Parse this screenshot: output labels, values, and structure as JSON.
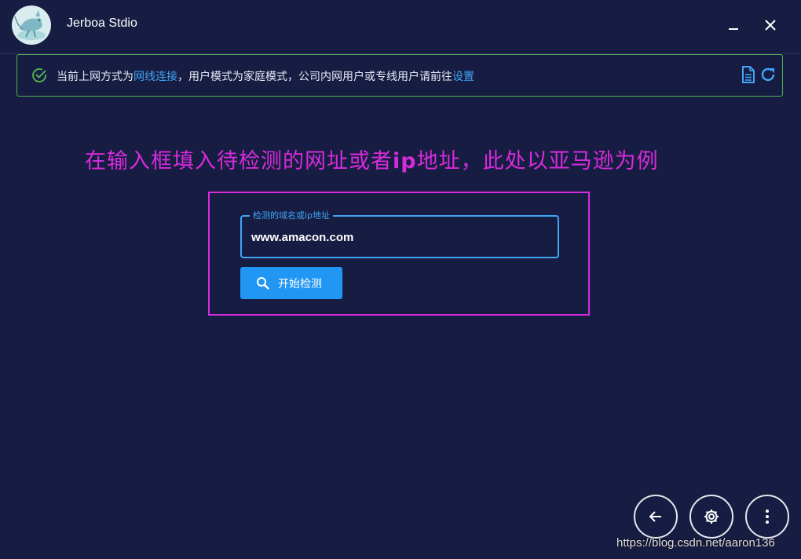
{
  "app": {
    "title": "Jerboa Stdio"
  },
  "banner": {
    "text_prefix": "当前上网方式为",
    "link_network": "网线连接",
    "text_middle": "，用户模式为家庭模式，公司内网用户或专线用户请前往",
    "link_settings": "设置",
    "status_color": "#4caf50",
    "link_color": "#42a5f5"
  },
  "instruction": {
    "text_before": "在输入框填入待检测的网址或者",
    "text_bold": "ip",
    "text_after": "地址，此处以亚马逊为例",
    "color": "#d62bdc"
  },
  "form": {
    "field_label": "检测的域名或ip地址",
    "field_value": "www.amacon.com",
    "start_button_label": "开始检测",
    "accent_color": "#2196f3"
  },
  "icons": {
    "check": "check-circle-icon",
    "document": "document-icon",
    "refresh": "refresh-icon",
    "search": "search-icon",
    "back": "arrow-left-icon",
    "settings": "gear-icon",
    "more": "more-vertical-icon",
    "minimize": "minimize-icon",
    "close": "close-icon"
  },
  "watermark": "https://blog.csdn.net/aaron136"
}
